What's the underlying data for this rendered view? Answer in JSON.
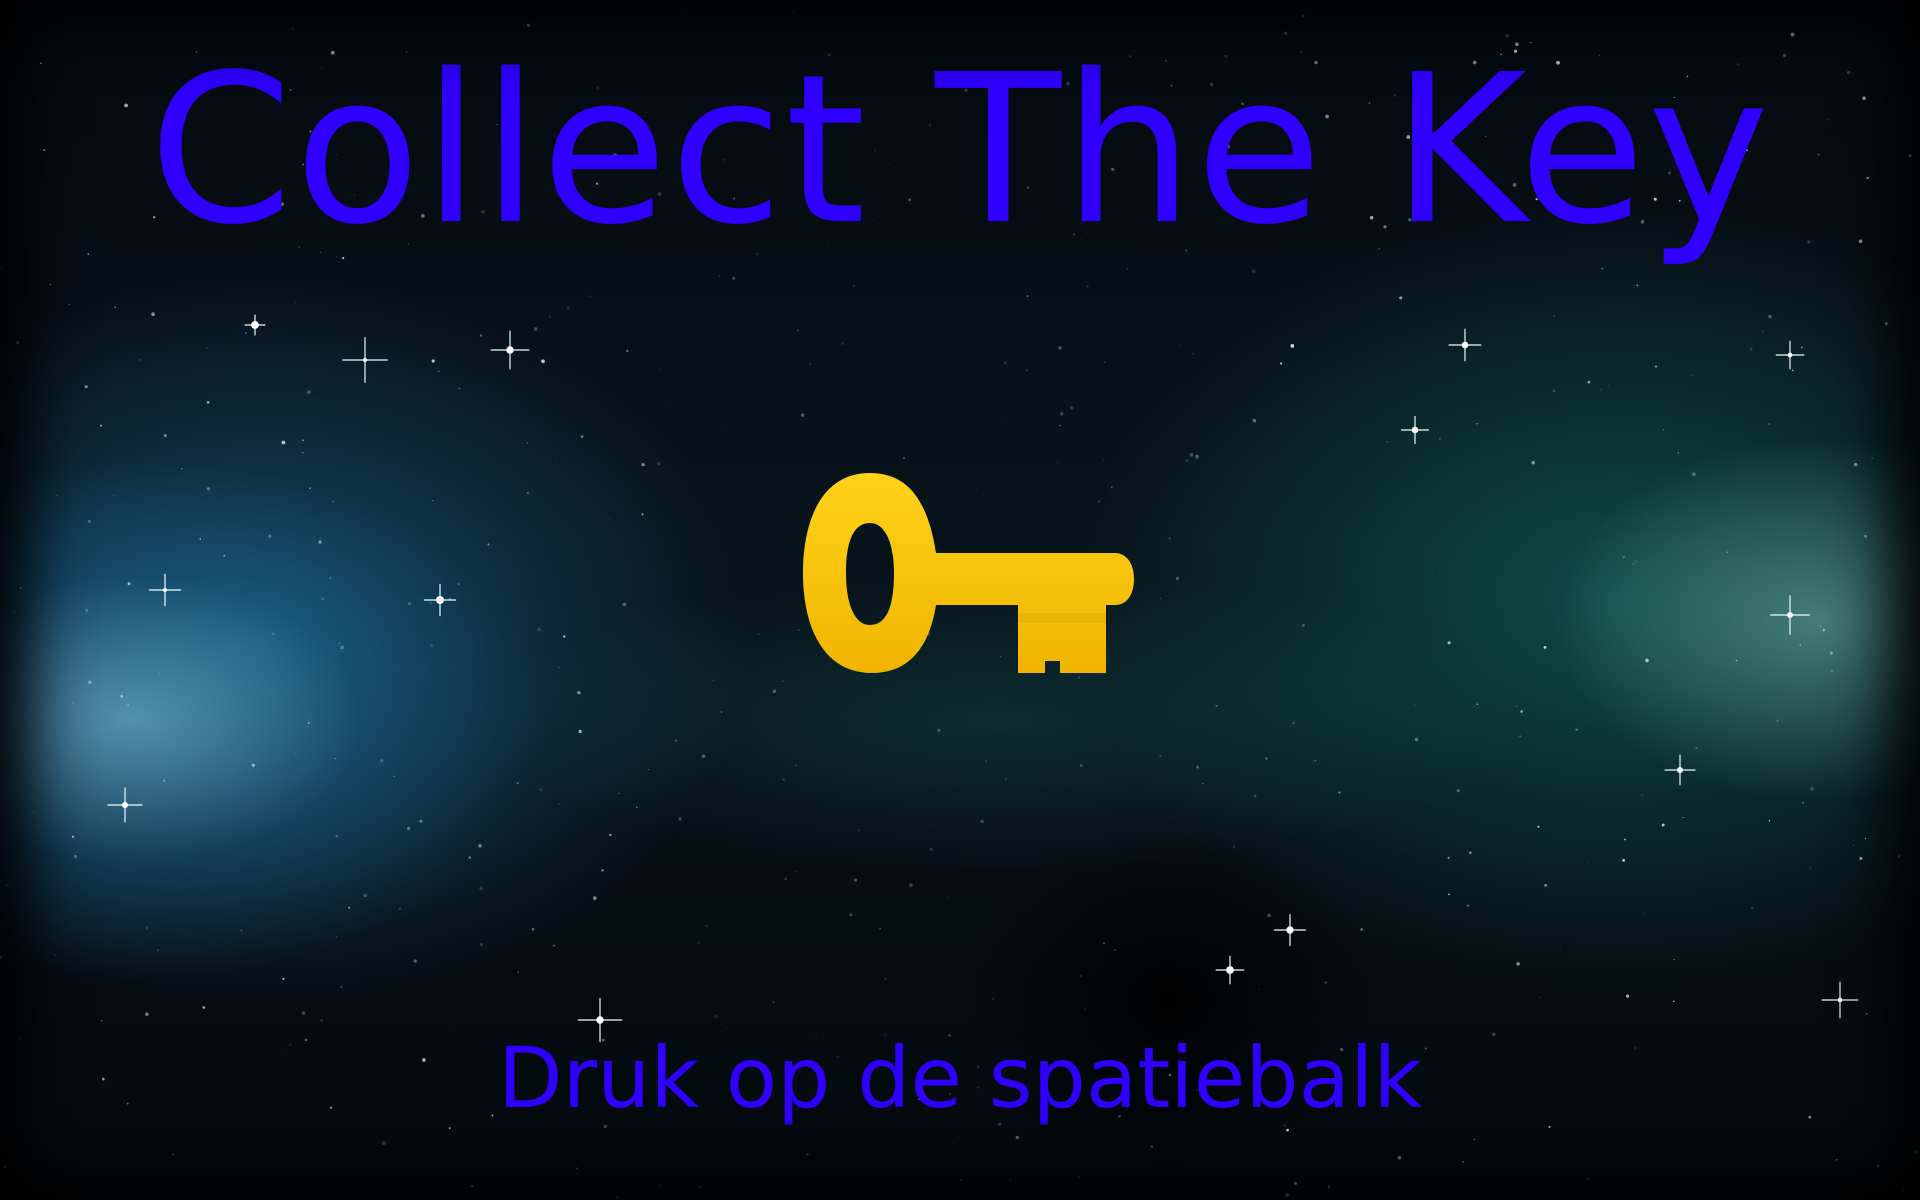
{
  "game": {
    "title": "Collect The Key",
    "prompt": "Druk op de spatiebalk"
  },
  "sprites": {
    "key": {
      "icon": "key-icon",
      "color": "#f5c400",
      "shade_color": "#e0a800"
    }
  },
  "colors": {
    "text": "#2f00ff",
    "space_left": "#5cc8ff",
    "space_right": "#3fbfa8"
  }
}
